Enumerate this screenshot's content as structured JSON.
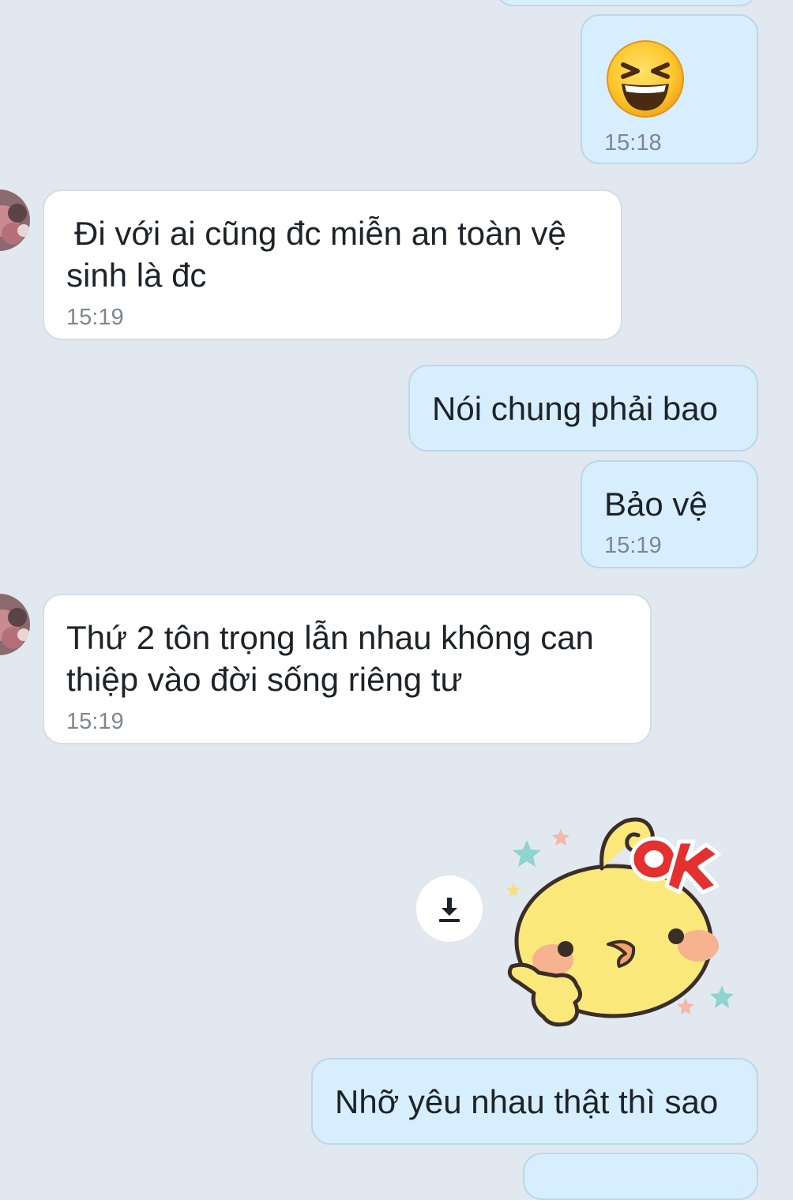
{
  "conversation": {
    "messages": [
      {
        "direction": "outgoing",
        "content": "laughing-squint-emoji",
        "time": "15:18"
      },
      {
        "direction": "incoming",
        "lines": [
          "Đi với ai cũng đc miễn an toàn vệ",
          "sinh là đc"
        ],
        "time": "15:19"
      },
      {
        "direction": "outgoing",
        "text": "Nói chung phải bao"
      },
      {
        "direction": "outgoing",
        "text": "Bảo vệ",
        "time": "15:19"
      },
      {
        "direction": "incoming",
        "lines": [
          "Thứ 2 tôn trọng lẫn nhau không can",
          "thiệp vào đời sống riêng tư"
        ],
        "time": "15:19"
      },
      {
        "direction": "outgoing",
        "content": "ok-chick-sticker",
        "sticker_text": "OK"
      },
      {
        "direction": "outgoing",
        "text": "Nhỡ yêu nhau thật thì sao"
      }
    ]
  },
  "icons": {
    "download": "download-icon",
    "emoji": "laughing-squint-emoji",
    "sticker": "ok-chick-sticker"
  },
  "colors": {
    "background": "#e2e8f0",
    "outgoing_bubble": "#d7eefe",
    "incoming_bubble": "#ffffff",
    "timestamp": "#7d8791"
  }
}
